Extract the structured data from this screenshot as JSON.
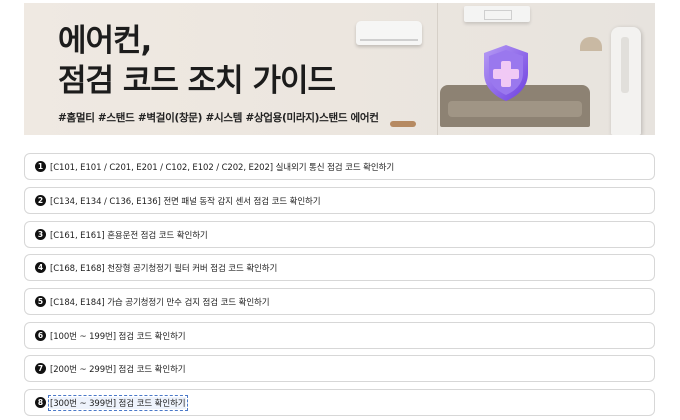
{
  "banner": {
    "title_line1": "에어컨,",
    "title_line2": "점검 코드 조치 가이드",
    "tags": "#홈멀티 #스탠드 #벽걸이(창문) #시스템 #상업용(미라지)스탠드 에어컨"
  },
  "icons": {
    "shield": "shield-plus-icon",
    "wall_ac": "wall-air-conditioner-icon",
    "ceiling_ac": "ceiling-air-conditioner-icon",
    "stand_ac": "stand-air-conditioner-icon"
  },
  "colors": {
    "shield": "#8a63e8",
    "number_badge": "#111111",
    "focus_outline": "#4a78c8"
  },
  "items": [
    {
      "num": "1",
      "label": "[C101, E101 / C201, E201 / C102, E102 / C202, E202] 실내외기 통신 점검 코드 확인하기"
    },
    {
      "num": "2",
      "label": "[C134, E134 / C136, E136] 전면 패널 동작 감지 센서 점검 코드 확인하기"
    },
    {
      "num": "3",
      "label": "[C161, E161] 혼용운전 점검 코드 확인하기"
    },
    {
      "num": "4",
      "label": "[C168, E168] 천장형 공기청정기 필터 커버 점검 코드 확인하기"
    },
    {
      "num": "5",
      "label": "[C184, E184] 가습 공기청정기 만수 검지 점검 코드 확인하기"
    },
    {
      "num": "6",
      "label": "[100번 ~ 199번] 점검 코드 확인하기"
    },
    {
      "num": "7",
      "label": "[200번 ~ 299번] 점검 코드 확인하기"
    },
    {
      "num": "8",
      "label": "[300번 ~ 399번] 점검 코드 확인하기"
    }
  ]
}
